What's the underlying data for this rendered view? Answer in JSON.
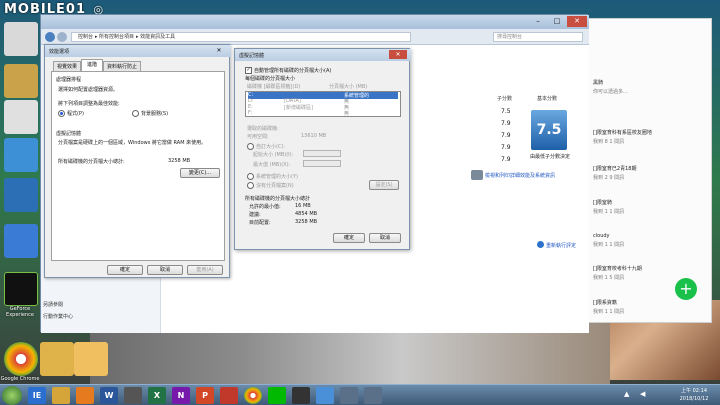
{
  "watermark": {
    "text": "MOBILE01",
    "symbol": "◎"
  },
  "desktop": {
    "icons": [
      {
        "name": "recycle-bin",
        "label": "Recycle Bin"
      },
      {
        "name": "google-chrome",
        "label": "Google Chrome"
      },
      {
        "name": "app-icon-1",
        "label": ""
      },
      {
        "name": "app-icon-2",
        "label": ""
      },
      {
        "name": "geforce-experience",
        "label": "GeForce Experience"
      },
      {
        "name": "folder",
        "label": ""
      }
    ]
  },
  "explorer": {
    "title": "",
    "breadcrumb": [
      "控制台",
      "所有控制台項目",
      "效能資訊及工具"
    ],
    "search_placeholder": "搜尋控制台",
    "left_links": [
      "另請參閱",
      "行動作業中心"
    ],
    "table_headers": {
      "subscore": "子分數",
      "base": "基本分數"
    },
    "scores": [
      "7.5",
      "7.9",
      "7.9",
      "7.9",
      "7.9"
    ],
    "base_score": "7.5",
    "base_caption": "由最低子分數決定",
    "details_link": "檢視和列印詳細效能及系統資訊",
    "rerun_link": "重新執行評定"
  },
  "perf_dialog": {
    "title": "效能選項",
    "tabs": [
      "視覺效果",
      "進階",
      "資料執行防止"
    ],
    "group1_title": "處理器排程",
    "group1_desc": "選擇如何配置處理器資源。",
    "group1_prompt": "將下列項目調整為最佳效能:",
    "radio_programs": "程式(P)",
    "radio_background": "背景服務(S)",
    "group2_title": "虛擬記憶體",
    "group2_desc": "分頁檔案是硬碟上的一個區域，Windows 將它當做 RAM 來使用。",
    "group2_total_label": "所有磁碟機的分頁檔大小總計:",
    "group2_total_value": "3258 MB",
    "change_button": "變更(C)...",
    "ok": "確定",
    "cancel": "取消",
    "apply": "套用(A)"
  },
  "vm_dialog": {
    "title": "虛擬記憶體",
    "auto_manage": "自動管理所有磁碟的分頁檔大小(A)",
    "per_drive_label": "每個磁碟的分頁檔大小",
    "col_drive": "磁碟機 [磁碟區標籤](D)",
    "col_size": "分頁檔大小 (MB)",
    "drives": [
      {
        "letter": "C:",
        "label": "",
        "size": "系統管理的"
      },
      {
        "letter": "D:",
        "label": "[DATA]",
        "size": "無"
      },
      {
        "letter": "E:",
        "label": "[新增磁碟區]",
        "size": "無"
      },
      {
        "letter": "F:",
        "label": "",
        "size": "無"
      }
    ],
    "selected_drive_label": "選取的磁碟機:",
    "space_available_label": "可用空間:",
    "space_available_value": "13610 MB",
    "custom_size": "自訂大小(C):",
    "initial_size": "起始大小 (MB)(I):",
    "max_size": "最大值 (MB)(X):",
    "system_managed": "系統管理的大小(Y)",
    "no_paging": "沒有分頁檔案(N)",
    "set_button": "設定(S)",
    "total_title": "所有磁碟機的分頁檔大小總計",
    "min_allowed_label": "允許的最小值:",
    "min_allowed_value": "16 MB",
    "recommended_label": "建議:",
    "recommended_value": "4854 MB",
    "allocated_label": "目前配置:",
    "allocated_value": "3258 MB",
    "ok": "確定",
    "cancel": "取消"
  },
  "side_panel": {
    "chats": [
      {
        "title": "黑騎",
        "sub": "你可以透過多…"
      },
      {
        "title": "[]限室育科有系區校友圈地",
        "sub": "我到 8 1 間訊"
      },
      {
        "title": "[]限室育已2青18期",
        "sub": "我到 2 9 間訊"
      },
      {
        "title": "[]限室騎",
        "sub": "我到 1 1 間訊"
      },
      {
        "title": "cloudy",
        "sub": "我到 1 1 間訊"
      },
      {
        "title": "[]限室育校考科十九期",
        "sub": "我到 1 5 間訊"
      },
      {
        "title": "[]限系資籍",
        "sub": "我到 1 1 間訊"
      }
    ],
    "fab_label": "+"
  },
  "taskbar": {
    "apps": [
      "IE",
      "Explorer",
      "Media",
      "Chrome",
      "Word",
      "Excel",
      "OneNote",
      "PowerPoint",
      "LINE",
      "Other"
    ],
    "time": "上午 02:14",
    "date": "2018/10/12"
  }
}
